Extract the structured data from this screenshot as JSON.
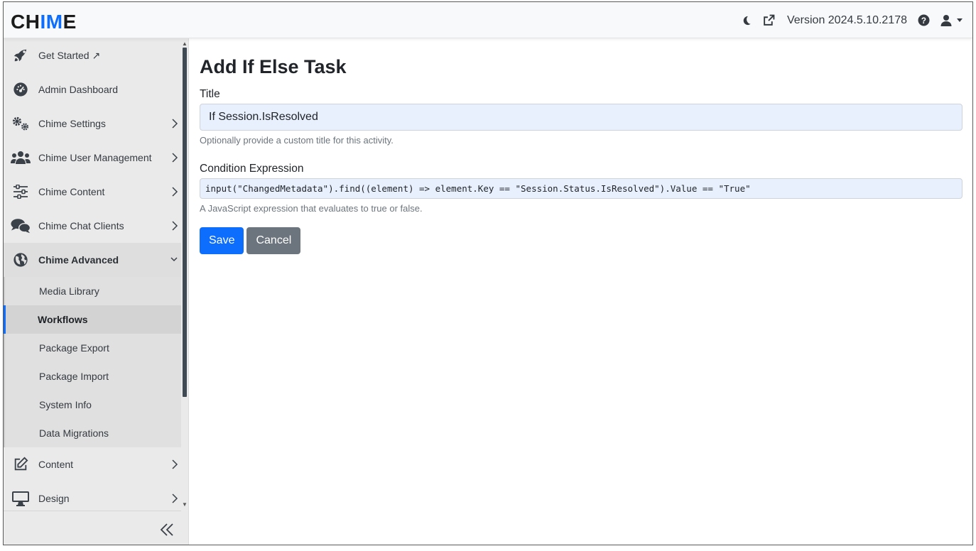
{
  "app": {
    "logo_part1": "CH",
    "logo_part2": "IM",
    "logo_part3": "E",
    "version": "Version 2024.5.10.2178",
    "accent_color": "#0d6efd"
  },
  "header": {
    "icons": [
      "moon-icon",
      "external-link-icon",
      "help-icon",
      "user-icon",
      "caret-down-icon"
    ]
  },
  "sidebar": {
    "items": [
      {
        "label": "Get Started ↗",
        "icon": "rocket-icon",
        "has_chevron": false
      },
      {
        "label": "Admin Dashboard",
        "icon": "dashboard-gauge-icon",
        "has_chevron": false
      },
      {
        "label": "Chime Settings",
        "icon": "gears-icon",
        "has_chevron": true
      },
      {
        "label": "Chime User Management",
        "icon": "users-icon",
        "has_chevron": true
      },
      {
        "label": "Chime Content",
        "icon": "sliders-icon",
        "has_chevron": true
      },
      {
        "label": "Chime Chat Clients",
        "icon": "comments-icon",
        "has_chevron": true
      },
      {
        "label": "Chime Advanced",
        "icon": "globe-icon",
        "has_chevron": true,
        "expanded": true
      },
      {
        "label": "Content",
        "icon": "edit-icon",
        "has_chevron": true
      },
      {
        "label": "Design",
        "icon": "desktop-icon",
        "has_chevron": true
      }
    ],
    "advanced_sub": [
      {
        "label": "Media Library"
      },
      {
        "label": "Workflows",
        "active": true
      },
      {
        "label": "Package Export"
      },
      {
        "label": "Package Import"
      },
      {
        "label": "System Info"
      },
      {
        "label": "Data Migrations"
      }
    ],
    "collapse_icon": "double-chevron-left-icon"
  },
  "form": {
    "heading": "Add If Else Task",
    "title_label": "Title",
    "title_value": "If Session.IsResolved",
    "title_help": "Optionally provide a custom title for this activity.",
    "condition_label": "Condition Expression",
    "condition_value": "input(\"ChangedMetadata\").find((element) => element.Key == \"Session.Status.IsResolved\").Value == \"True\"",
    "condition_help": "A JavaScript expression that evaluates to true or false.",
    "save_label": "Save",
    "cancel_label": "Cancel"
  }
}
